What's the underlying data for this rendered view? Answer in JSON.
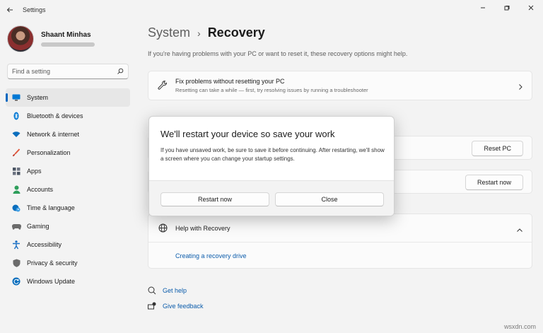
{
  "window": {
    "title": "Settings"
  },
  "profile": {
    "name": "Shaant Minhas"
  },
  "search": {
    "placeholder": "Find a setting"
  },
  "sidebar": {
    "items": [
      {
        "label": "System",
        "icon": "monitor-icon",
        "color": "#0078d4",
        "active": true
      },
      {
        "label": "Bluetooth & devices",
        "icon": "bluetooth-icon",
        "color": "#0078d4"
      },
      {
        "label": "Network & internet",
        "icon": "wifi-icon",
        "color": "#0a6ebd"
      },
      {
        "label": "Personalization",
        "icon": "brush-icon",
        "color": "#e0593e"
      },
      {
        "label": "Apps",
        "icon": "apps-icon",
        "color": "#4b5563"
      },
      {
        "label": "Accounts",
        "icon": "person-icon",
        "color": "#2e9e5b"
      },
      {
        "label": "Time & language",
        "icon": "globe-clock-icon",
        "color": "#0a6ebd"
      },
      {
        "label": "Gaming",
        "icon": "gamepad-icon",
        "color": "#6b6b6b"
      },
      {
        "label": "Accessibility",
        "icon": "accessibility-icon",
        "color": "#1a6fc4"
      },
      {
        "label": "Privacy & security",
        "icon": "shield-icon",
        "color": "#6b6b6b"
      },
      {
        "label": "Windows Update",
        "icon": "update-icon",
        "color": "#0a6ebd"
      }
    ]
  },
  "main": {
    "breadcrumb": {
      "parent": "System",
      "current": "Recovery"
    },
    "intro": "If you're having problems with your PC or want to reset it, these recovery options might help.",
    "fix_card": {
      "title": "Fix problems without resetting your PC",
      "desc": "Resetting can take a while — first, try resolving issues by running a troubleshooter"
    },
    "reset_button": "Reset PC",
    "restart_button": "Restart now",
    "help": {
      "title": "Help with Recovery",
      "link": "Creating a recovery drive"
    },
    "footer": {
      "get_help": "Get help",
      "give_feedback": "Give feedback"
    }
  },
  "dialog": {
    "title": "We'll restart your device so save your work",
    "text": "If you have unsaved work, be sure to save it before continuing. After restarting, we'll show a screen where you can change your startup settings.",
    "primary": "Restart now",
    "secondary": "Close"
  },
  "watermark": "wsxdn.com",
  "colors": {
    "accent": "#0067c0",
    "link": "#0b5cab",
    "background": "#f3f3f3"
  }
}
